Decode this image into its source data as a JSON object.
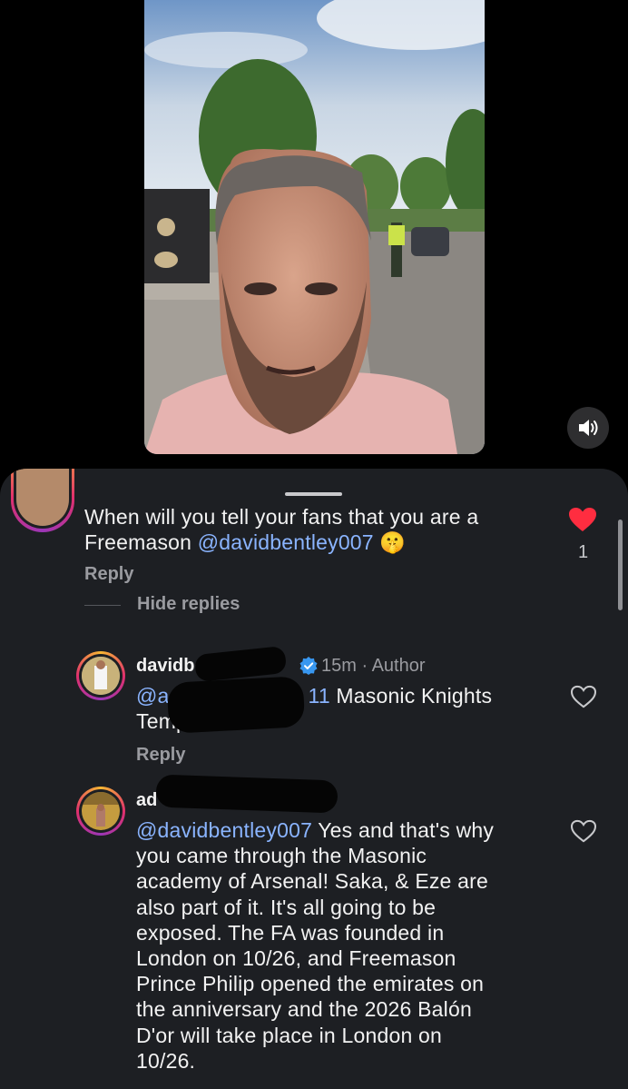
{
  "video": {
    "sound_icon": "speaker-icon"
  },
  "comments": {
    "parent": {
      "text_line1": "When will you tell your fans that you are a",
      "text_prefix": "Freemason ",
      "mention": "@davidbentley007",
      "emoji": "🤫",
      "reply_label": "Reply",
      "hide_replies_label": "Hide replies",
      "like_count": "1",
      "liked": true
    },
    "replies": [
      {
        "username": "davidbentley007",
        "verified": true,
        "time": "15m",
        "author_tag": "· Author",
        "mention_visible": "@ad",
        "mention_tail": "11",
        "text_line1_suffix": " Masonic Knights",
        "text_line2": "Templar",
        "reply_label": "Reply"
      },
      {
        "username": "ad",
        "mention": "@davidbentley007",
        "lines": [
          " Yes and that's why",
          "you came through the Masonic",
          "academy of Arsenal! Saka, & Eze are",
          "also part of it. It's all going to be",
          "exposed. The FA was founded in",
          "London on 10/26, and Freemason",
          "Prince Philip opened the emirates on",
          "the anniversary and the 2026 Balón",
          "D'or will take place in London on",
          "10/26."
        ]
      }
    ]
  },
  "colors": {
    "sheet_bg": "#1d1f23",
    "mention": "#8ab4ff",
    "like_red": "#ff2d40",
    "muted": "#9a9ba0"
  }
}
